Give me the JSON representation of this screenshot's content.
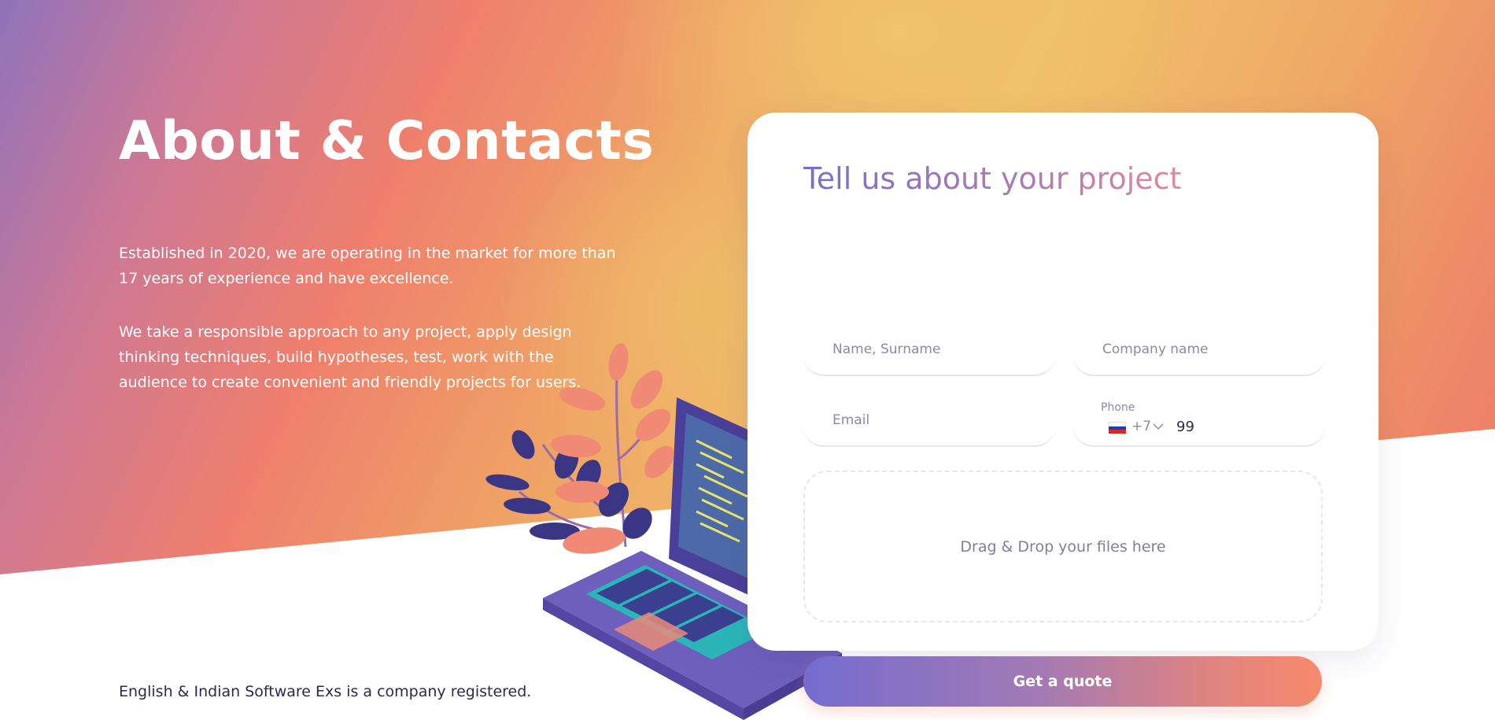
{
  "page": {
    "title": "About & Contacts",
    "about_paragraph_1": "Established in 2020, we are operating in the market for more than 17 years of experience and have excellence.",
    "about_paragraph_2": "We take a responsible approach to any project, apply design thinking techniques, build hypotheses, test, work with the audience to create convenient and friendly projects for users.",
    "footer_note": "English & Indian Software Exs is a company registered."
  },
  "form": {
    "title": "Tell us about your project",
    "name": {
      "placeholder": "Name, Surname",
      "value": ""
    },
    "company": {
      "placeholder": "Company name",
      "value": ""
    },
    "email": {
      "placeholder": "Email",
      "value": ""
    },
    "phone": {
      "label": "Phone",
      "country_code": "+7",
      "value": "99",
      "flag_icon": "russia-flag-icon"
    },
    "dropzone_label": "Drag & Drop your files here",
    "submit_label": "Get a quote"
  },
  "colors": {
    "gradient_start": "#8f73bb",
    "gradient_mid": "#ef7f6d",
    "gradient_warm": "#f0c06a",
    "button_start": "#756ccf",
    "button_end": "#f88a6d",
    "text_dark": "#2b2a4c",
    "muted_text": "#8a8aa8"
  },
  "icons": {
    "chevron": "chevron-down-icon",
    "illustration": "laptop-plant-illustration"
  }
}
